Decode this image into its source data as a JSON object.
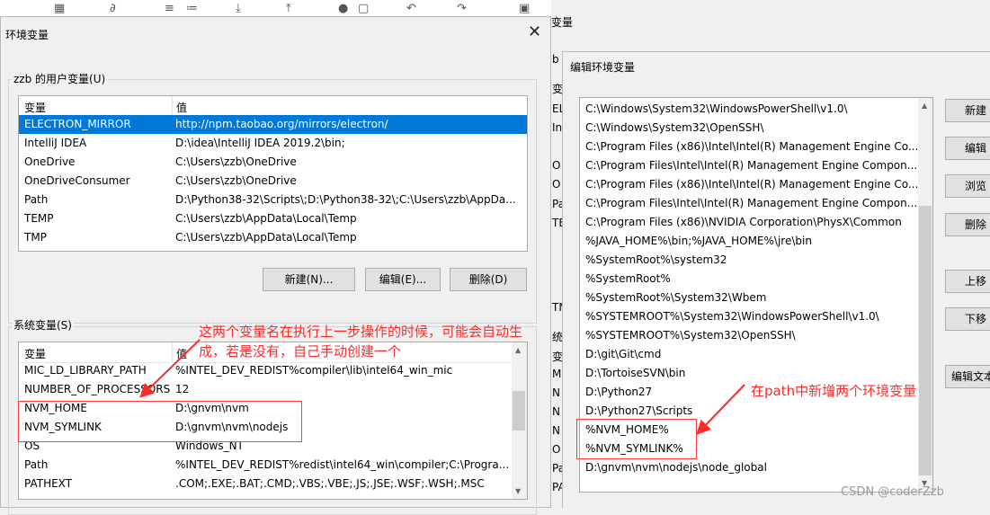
{
  "left_window": {
    "title": "环境变量",
    "close_glyph": "✕",
    "user_group_label": "zzb 的用户变量(U)",
    "sys_group_label": "系统变量(S)",
    "columns": [
      "变量",
      "值"
    ],
    "user_vars": [
      {
        "name": "ELECTRON_MIRROR",
        "value": "http://npm.taobao.org/mirrors/electron/",
        "selected": true
      },
      {
        "name": "IntelliJ IDEA",
        "value": "D:\\idea\\IntelliJ IDEA 2019.2\\bin;"
      },
      {
        "name": "OneDrive",
        "value": "C:\\Users\\zzb\\OneDrive"
      },
      {
        "name": "OneDriveConsumer",
        "value": "C:\\Users\\zzb\\OneDrive"
      },
      {
        "name": "Path",
        "value": "D:\\Python38-32\\Scripts\\;D:\\Python38-32\\;C:\\Users\\zzb\\AppDa..."
      },
      {
        "name": "TEMP",
        "value": "C:\\Users\\zzb\\AppData\\Local\\Temp"
      },
      {
        "name": "TMP",
        "value": "C:\\Users\\zzb\\AppData\\Local\\Temp"
      }
    ],
    "user_buttons": [
      "新建(N)...",
      "编辑(E)...",
      "删除(D)"
    ],
    "sys_vars": [
      {
        "name": "MIC_LD_LIBRARY_PATH",
        "value": "%INTEL_DEV_REDIST%compiler\\lib\\intel64_win_mic"
      },
      {
        "name": "NUMBER_OF_PROCESSORS",
        "value": "12"
      },
      {
        "name": "NVM_HOME",
        "value": "D:\\gnvm\\nvm"
      },
      {
        "name": "NVM_SYMLINK",
        "value": "D:\\gnvm\\nvm\\nodejs"
      },
      {
        "name": "OS",
        "value": "Windows_NT"
      },
      {
        "name": "Path",
        "value": "%INTEL_DEV_REDIST%redist\\intel64_win\\compiler;C:\\Progra..."
      },
      {
        "name": "PATHEXT",
        "value": ".COM;.EXE;.BAT;.CMD;.VBS;.VBE;.JS;.JSE;.WSF;.WSH;.MSC"
      }
    ]
  },
  "bg_window": {
    "title_fragment": "变量",
    "fragments": [
      "b",
      "变",
      "EL",
      "In",
      "O",
      "O",
      "Pa",
      "TE",
      "TM",
      "统",
      "变",
      "M",
      "N",
      "N",
      "N",
      "O",
      "Pa",
      "PA"
    ]
  },
  "right_window": {
    "title": "编辑环境变量",
    "entries": [
      "C:\\Windows\\System32\\WindowsPowerShell\\v1.0\\",
      "C:\\Windows\\System32\\OpenSSH\\",
      "C:\\Program Files (x86)\\Intel\\Intel(R) Management Engine Co...",
      "C:\\Program Files\\Intel\\Intel(R) Management Engine Compon...",
      "C:\\Program Files (x86)\\Intel\\Intel(R) Management Engine Co...",
      "C:\\Program Files\\Intel\\Intel(R) Management Engine Compon...",
      "C:\\Program Files (x86)\\NVIDIA Corporation\\PhysX\\Common",
      "%JAVA_HOME%\\bin;%JAVA_HOME%\\jre\\bin",
      "%SystemRoot%\\system32",
      "%SystemRoot%",
      "%SystemRoot%\\System32\\Wbem",
      "%SYSTEMROOT%\\System32\\WindowsPowerShell\\v1.0\\",
      "%SYSTEMROOT%\\System32\\OpenSSH\\",
      "D:\\git\\Git\\cmd",
      "D:\\TortoiseSVN\\bin",
      "D:\\Python27",
      "D:\\Python27\\Scripts",
      "%NVM_HOME%",
      "%NVM_SYMLINK%",
      "D:\\gnvm\\nvm\\nodejs\\node_global"
    ],
    "buttons": [
      "新建",
      "编辑",
      "浏览",
      "删除",
      "上移",
      "下移",
      "编辑文本"
    ]
  },
  "annotations": {
    "left_line1": "这两个变量名在执行上一步操作的时候，可能会自动生",
    "left_line2": "成，若是没有，自己手动创建一个",
    "right": "在path中新增两个环境变量",
    "accent_color": "#ff2a2a"
  },
  "watermark": "CSDN @coderZzb"
}
